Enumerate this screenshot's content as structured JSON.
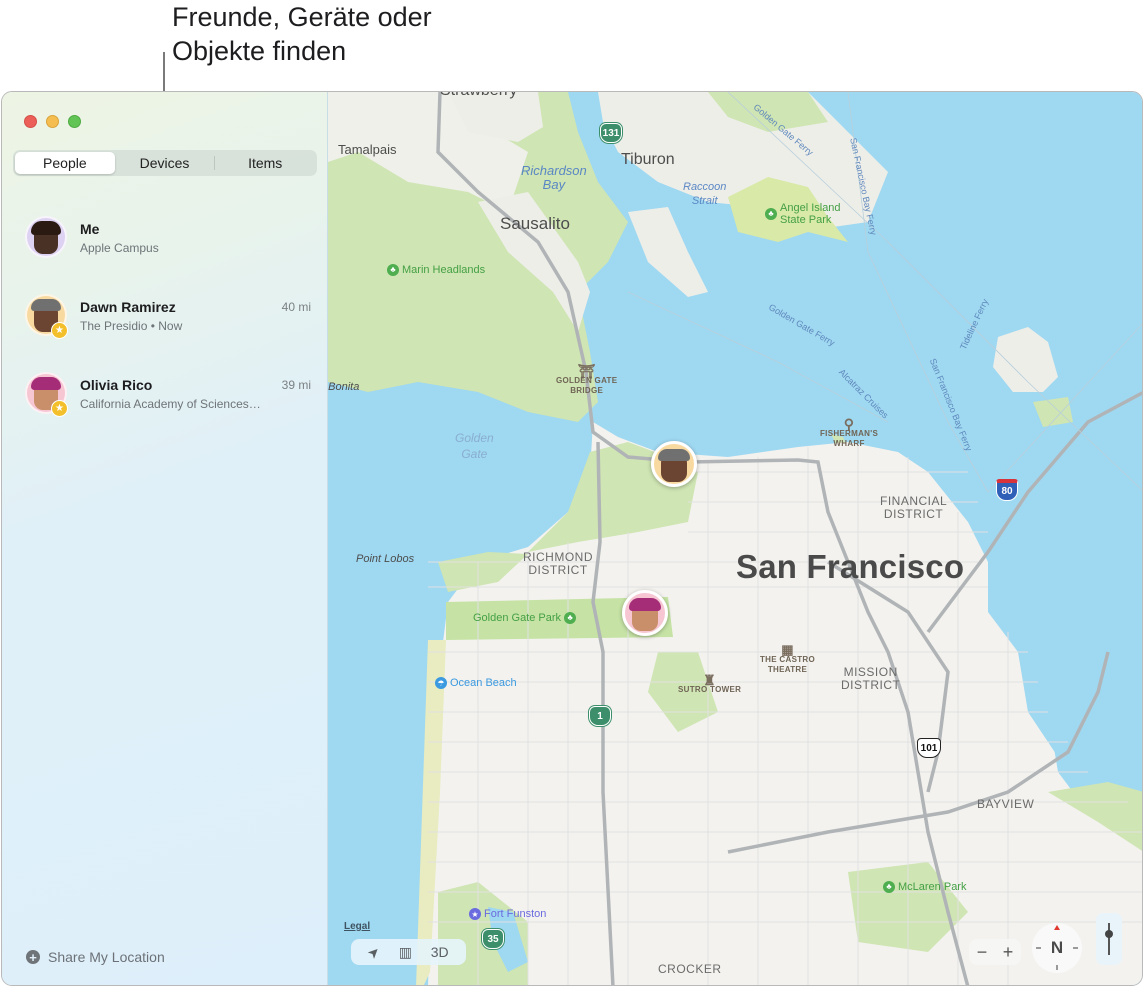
{
  "callout": {
    "text": "Freunde, Geräte oder\nObjekte finden"
  },
  "window": {
    "traffic_lights": {
      "close": "#ec5f59",
      "minimize": "#f5bd4f",
      "zoom": "#61c454"
    }
  },
  "tabs": [
    {
      "label": "People",
      "selected": true
    },
    {
      "label": "Devices",
      "selected": false
    },
    {
      "label": "Items",
      "selected": false
    }
  ],
  "people": [
    {
      "name": "Me",
      "subtitle": "Apple Campus",
      "distance": "",
      "favorite": false,
      "avatar_icon": "memoji-me-avatar"
    },
    {
      "name": "Dawn Ramirez",
      "subtitle": "The Presidio • Now",
      "distance": "40 mi",
      "favorite": true,
      "avatar_icon": "memoji-dawn-avatar"
    },
    {
      "name": "Olivia Rico",
      "subtitle": "California Academy of Sciences…",
      "distance": "39 mi",
      "favorite": true,
      "avatar_icon": "memoji-olivia-avatar"
    }
  ],
  "sidebar_footer": {
    "share_location_label": "Share My Location",
    "icon": "plus-circle-icon"
  },
  "map": {
    "labels": {
      "strawberry": "Strawberry",
      "tamalpais": "Tamalpais",
      "richardson_bay": "Richardson\nBay",
      "tiburon": "Tiburon",
      "raccoon_strait": "Raccoon\nStrait",
      "angel_island": "Angel Island\nState Park",
      "sausalito": "Sausalito",
      "marin_headlands": "Marin Headlands",
      "point_bonita": "Point Bonita",
      "golden_gate_bridge": "GOLDEN GATE\nBRIDGE",
      "golden_gate": "Golden\nGate",
      "fishermans_wharf": "FISHERMAN'S\nWHARF",
      "financial_district": "FINANCIAL\nDISTRICT",
      "point_lobos": "Point Lobos",
      "richmond_district": "RICHMOND\nDISTRICT",
      "san_francisco": "San Francisco",
      "golden_gate_park": "Golden Gate Park",
      "the_castro_theatre": "THE CASTRO\nTHEATRE",
      "mission_district": "MISSION\nDISTRICT",
      "ocean_beach": "Ocean Beach",
      "sutro_tower": "SUTRO TOWER",
      "bayview": "BAYVIEW",
      "mclaren_park": "McLaren Park",
      "fort_funston": "Fort Funston",
      "crocker": "CROCKER"
    },
    "ferries": {
      "gg_ferry_1": "Golden Gate Ferry",
      "sf_bay_ferry_1": "San Francisco Bay Ferry",
      "gg_ferry_2": "Golden Gate Ferry",
      "alcatraz": "Alcatraz Cruises",
      "sf_bay_ferry_2": "San Francisco Bay Ferry",
      "tideline": "Tideline Ferry"
    },
    "shields": {
      "ca_131": "131",
      "ca_1": "1",
      "ca_35": "35",
      "i_80": "80",
      "us_101": "101"
    },
    "legal_label": "Legal",
    "controls": {
      "location_icon": "location-arrow-icon",
      "map_icon": "map-icon",
      "three_d_label": "3D",
      "zoom_out": "−",
      "zoom_in": "+",
      "compass_label": "N"
    },
    "colors": {
      "water": "#9fd8f1",
      "land": "#f3f2ee",
      "park": "#cfe7b0",
      "road": "#b6b9bb"
    }
  }
}
